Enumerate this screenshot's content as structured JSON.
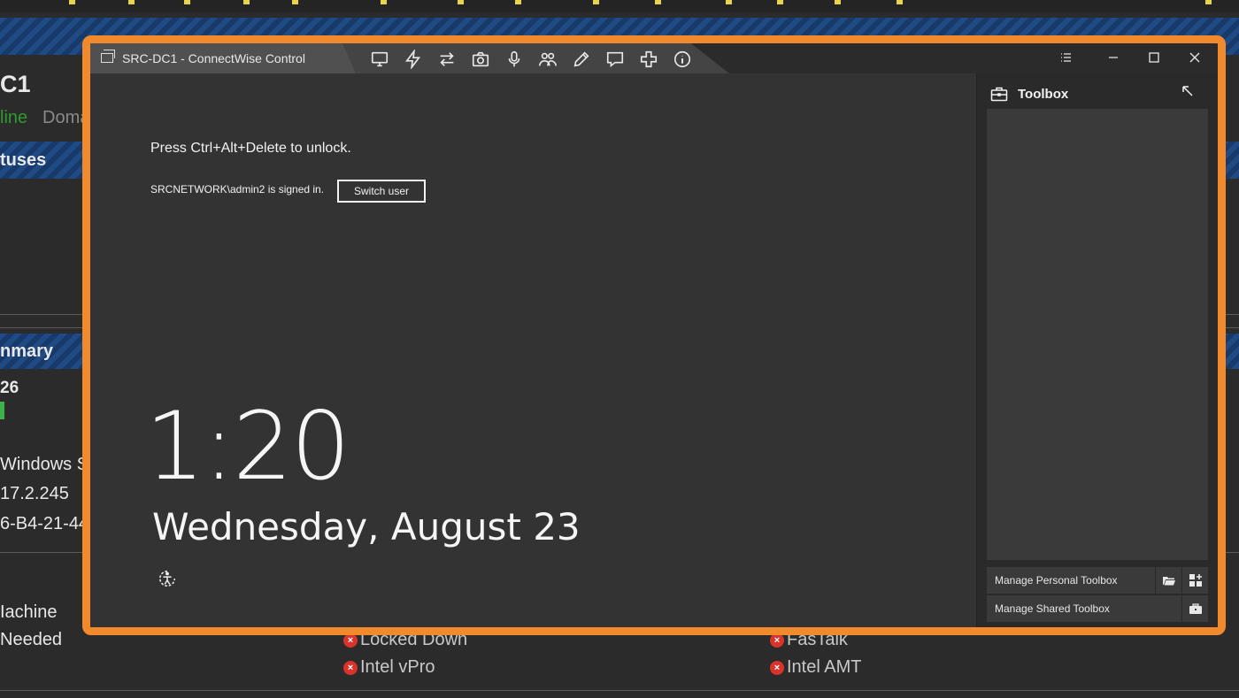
{
  "background": {
    "headings": [
      "C1",
      "tuses",
      "nmary"
    ],
    "status": {
      "online": "line",
      "domain": "Doma"
    },
    "summary": {
      "count": "26",
      "os": "Windows S",
      "version": "17.2.245",
      "mac": "6-B4-21-44"
    },
    "left_items": [
      "Iachine",
      "Needed"
    ],
    "checks": [
      {
        "label": "Locked Down"
      },
      {
        "label": "FasTalk"
      },
      {
        "label": "Intel vPro"
      },
      {
        "label": "Intel AMT"
      }
    ],
    "check_glyph": "×"
  },
  "window": {
    "title": "SRC-DC1 - ConnectWise Control",
    "toolbar": [
      {
        "name": "screen-icon"
      },
      {
        "name": "lightning-icon"
      },
      {
        "name": "transfer-icon"
      },
      {
        "name": "camera-icon"
      },
      {
        "name": "microphone-icon"
      },
      {
        "name": "users-icon"
      },
      {
        "name": "pen-icon"
      },
      {
        "name": "chat-icon"
      },
      {
        "name": "plus-icon"
      },
      {
        "name": "info-icon"
      }
    ]
  },
  "lockscreen": {
    "unlock_text": "Press Ctrl+Alt+Delete to unlock.",
    "signed_in_text": "SRCNETWORK\\admin2 is signed in.",
    "switch_user_label": "Switch user",
    "time": "1:20",
    "date": "Wednesday, August 23"
  },
  "toolbox": {
    "title": "Toolbox",
    "manage_personal": "Manage Personal Toolbox",
    "manage_shared": "Manage Shared Toolbox"
  },
  "colors": {
    "frame_accent": "#f08a2c",
    "stripe_blue": "#1f4a84",
    "online_green": "#2e9b2e",
    "error_red": "#d9342b"
  }
}
